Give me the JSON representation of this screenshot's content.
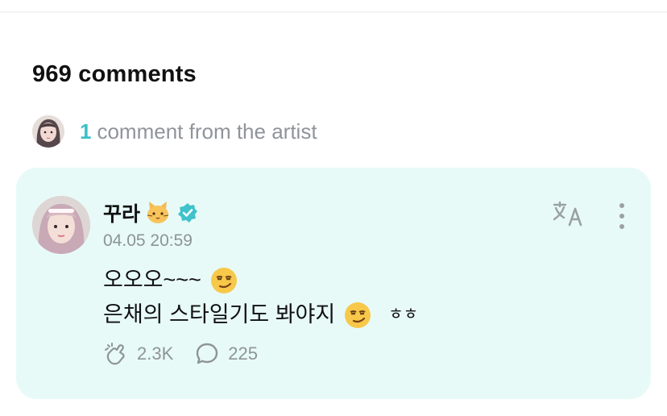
{
  "comments": {
    "count_title": "969 comments"
  },
  "artist_summary": {
    "count": "1",
    "label": "comment from the artist"
  },
  "comment": {
    "author": "꾸라",
    "timestamp": "04.05 20:59",
    "lines": [
      "오오오~~~",
      "은채의 스타일기도 봐야지"
    ],
    "suffix": "ㅎㅎ",
    "likes": "2.3K",
    "replies": "225"
  },
  "icons": {
    "cat": "cat-face-icon",
    "verified": "verified-badge-icon",
    "smirk": "smirking-face-icon",
    "translate": "translate-icon",
    "more": "more-vertical-icon",
    "like": "cheer-hand-icon",
    "reply": "comment-bubble-icon"
  },
  "colors": {
    "accent": "#3cc0c7",
    "card_bg": "#e7faf7",
    "muted_text": "#8e9499"
  }
}
